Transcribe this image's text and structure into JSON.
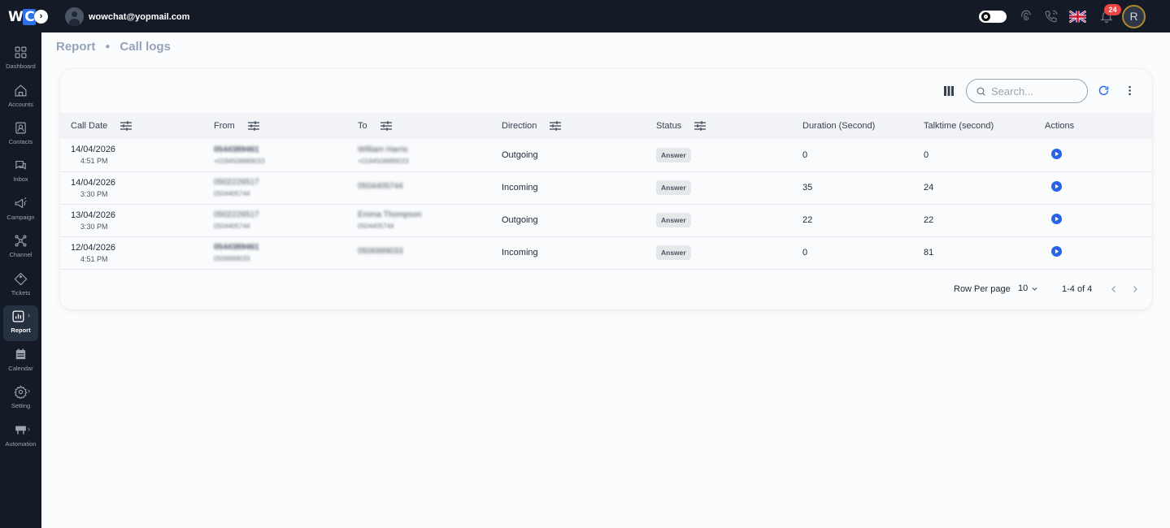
{
  "app": {
    "logo_text_w": "W",
    "logo_text_c": "C",
    "user_email": "wowchat@yopmail.com",
    "notification_count": "24",
    "profile_initial": "R"
  },
  "sidebar": {
    "items": [
      {
        "label": "Dashboard",
        "icon": "dashboard-icon"
      },
      {
        "label": "Accounts",
        "icon": "home-icon"
      },
      {
        "label": "Contacts",
        "icon": "contact-card-icon"
      },
      {
        "label": "Inbox",
        "icon": "chat-icon"
      },
      {
        "label": "Campaign",
        "icon": "megaphone-icon"
      },
      {
        "label": "Channel",
        "icon": "network-icon"
      },
      {
        "label": "Tickets",
        "icon": "ticket-icon"
      },
      {
        "label": "Report",
        "icon": "report-chart-icon"
      },
      {
        "label": "Calendar",
        "icon": "calendar-icon"
      },
      {
        "label": "Setting",
        "icon": "gear-icon"
      },
      {
        "label": "Automation",
        "icon": "automation-icon"
      }
    ]
  },
  "breadcrumb": {
    "parent": "Report",
    "current": "Call logs"
  },
  "toolbar": {
    "search_placeholder": "Search..."
  },
  "table": {
    "columns": [
      "Call Date",
      "From",
      "To",
      "Direction",
      "Status",
      "Duration (Second)",
      "Talktime (second)",
      "Actions"
    ],
    "rows": [
      {
        "date": "14/04/2026",
        "time": "4:51 PM",
        "from_main": "0544389461",
        "from_sub": "+0184508889033",
        "to_main": "William Harris",
        "to_sub": "+0184508889033",
        "direction": "Outgoing",
        "status": "Answer",
        "duration": "0",
        "talktime": "0"
      },
      {
        "date": "14/04/2026",
        "time": "3:30 PM",
        "from_main": "0502226517",
        "from_sub": "0504405744",
        "to_main": "0504405744",
        "to_sub": "",
        "direction": "Incoming",
        "status": "Answer",
        "duration": "35",
        "talktime": "24"
      },
      {
        "date": "13/04/2026",
        "time": "3:30 PM",
        "from_main": "0502226517",
        "from_sub": "0504405744",
        "to_main": "Emma Thompson",
        "to_sub": "0504405744",
        "direction": "Outgoing",
        "status": "Answer",
        "duration": "22",
        "talktime": "22"
      },
      {
        "date": "12/04/2026",
        "time": "4:51 PM",
        "from_main": "0544389461",
        "from_sub": "0506999033",
        "to_main": "0506999033",
        "to_sub": "",
        "direction": "Incoming",
        "status": "Answer",
        "duration": "0",
        "talktime": "81"
      }
    ]
  },
  "pagination": {
    "rows_per_page_label": "Row Per page",
    "rows_per_page_value": "10",
    "range": "1-4 of 4"
  },
  "colors": {
    "topbar": "#151b26",
    "accent": "#2563eb",
    "notification": "#ef4444"
  }
}
